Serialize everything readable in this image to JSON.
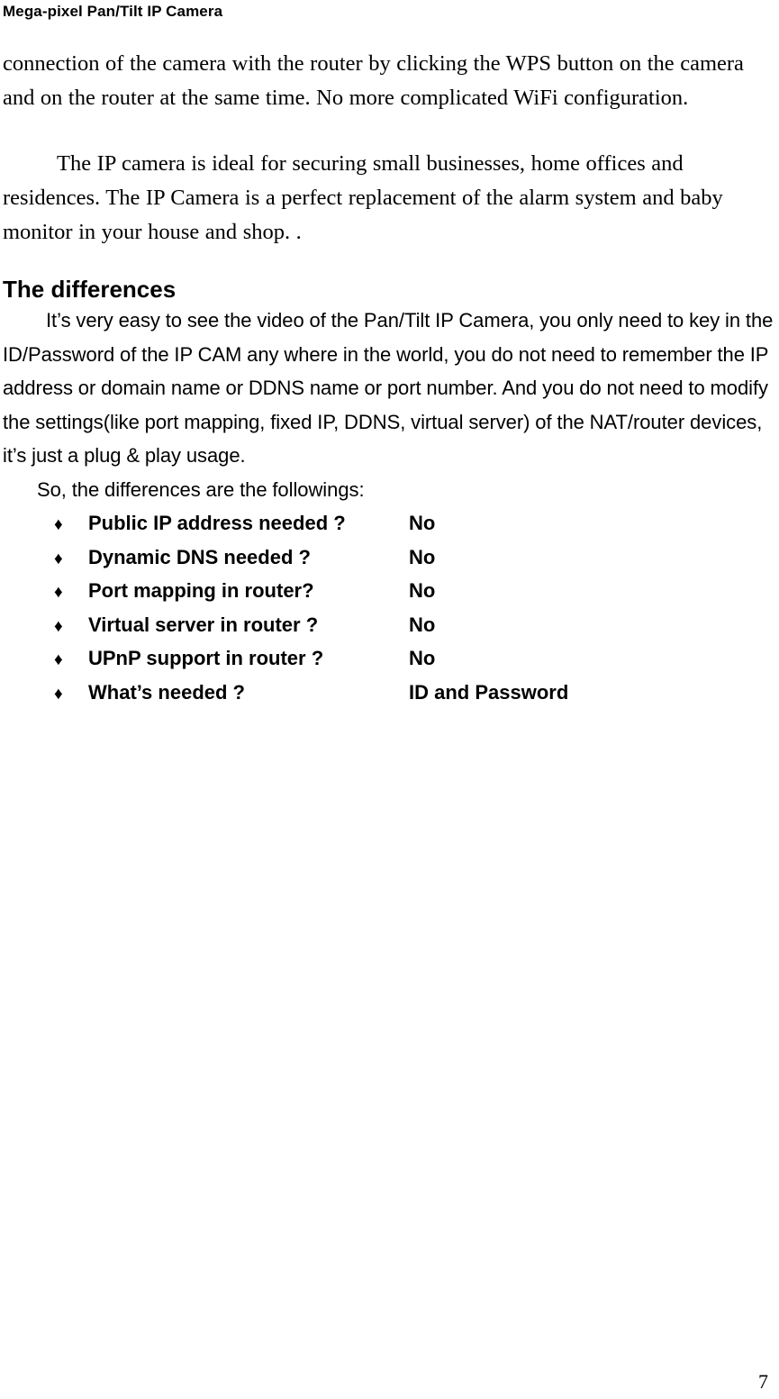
{
  "document": {
    "running_header": "Mega-pixel Pan/Tilt IP Camera",
    "page_number": "7"
  },
  "body": {
    "paragraph_continued": "connection of the camera with the router by clicking the WPS button on the camera and on the router at the same time. No more complicated WiFi configuration.",
    "paragraph_ideal": "The IP camera is ideal for securing small businesses, home offices and residences. The IP Camera is a perfect replacement of the alarm system and baby monitor in your house and shop. ."
  },
  "section": {
    "heading": "The differences",
    "intro_paragraph": "It’s very easy to see the video of the Pan/Tilt IP Camera, you only need to key in the ID/Password of the IP CAM any where in the world, you do not need to remember the IP address or domain name or DDNS name or port number. And you do not need to modify the settings(like port mapping, fixed IP, DDNS, virtual server) of the NAT/router devices, it’s just a plug & play usage.",
    "list_lead_in": "So, the differences are the followings:",
    "bullet_glyph": "♦",
    "items": [
      {
        "question": "Public IP address needed ?",
        "answer": "No"
      },
      {
        "question": "Dynamic DNS needed ?",
        "answer": "No"
      },
      {
        "question": "Port mapping in router?",
        "answer": "No"
      },
      {
        "question": "Virtual server in router ?",
        "answer": "No"
      },
      {
        "question": "UPnP support in router ?",
        "answer": "No"
      },
      {
        "question": "What’s needed ?",
        "answer": "ID and Password"
      }
    ]
  },
  "colors": {
    "text": "#000000",
    "background": "#ffffff"
  }
}
